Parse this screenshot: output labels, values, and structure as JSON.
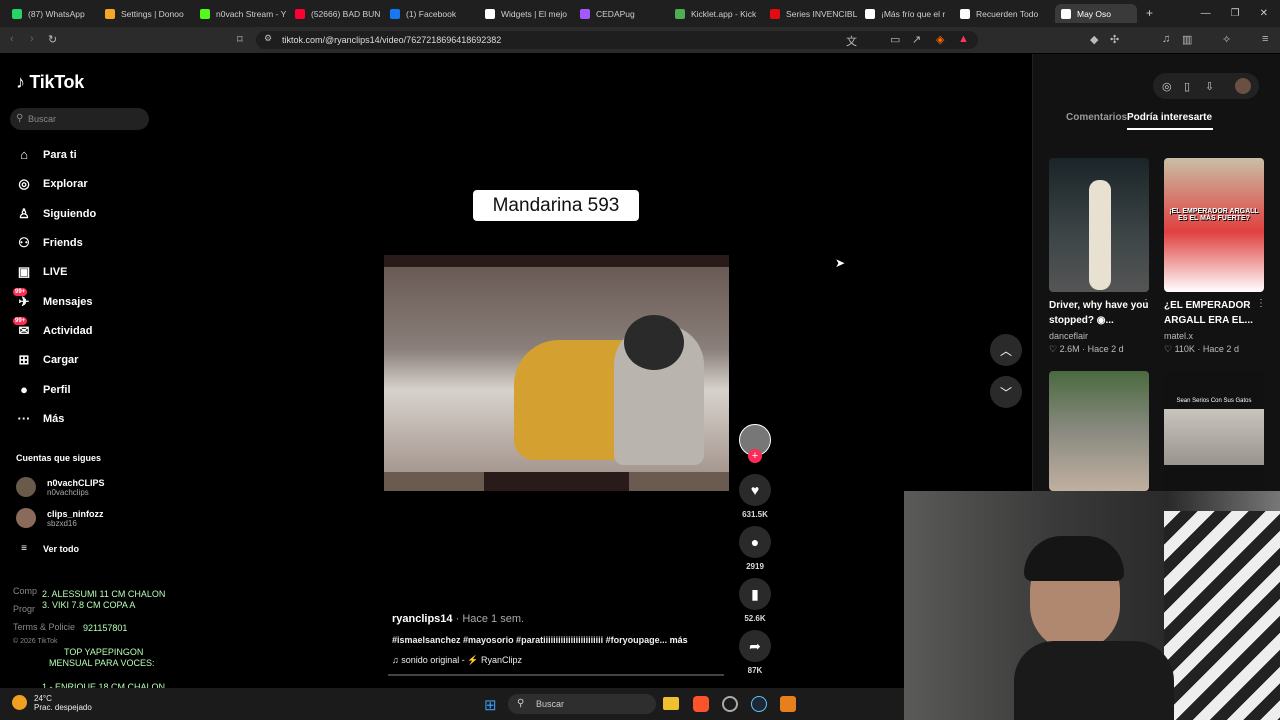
{
  "browser": {
    "tabs": [
      {
        "label": "(87) WhatsApp",
        "color": "#25d366"
      },
      {
        "label": "Settings | Donoo",
        "color": "#f5a623"
      },
      {
        "label": "n0vach Stream - Y",
        "color": "#53fc18"
      },
      {
        "label": "(52666) BAD BUN",
        "color": "#ff0033"
      },
      {
        "label": "(1) Facebook",
        "color": "#1877f2"
      },
      {
        "label": "Widgets | El mejo",
        "color": "#ffffff"
      },
      {
        "label": "CEDAPug",
        "color": "#a259ff"
      },
      {
        "label": "Kicklet.app - Kick",
        "color": "#4caf50"
      },
      {
        "label": "Series INVENCIBL",
        "color": "#e50914"
      },
      {
        "label": "¡Más frío que el r",
        "color": "#ffffff"
      },
      {
        "label": "Recuerden Todo",
        "color": "#ffffff"
      },
      {
        "label": "May Oso",
        "color": "#ffffff"
      }
    ],
    "new_tab": "+",
    "url": "tiktok.com/@ryanclips14/video/7627218696418692382"
  },
  "sidebar": {
    "logo": "TikTok",
    "search_placeholder": "Buscar",
    "items": [
      {
        "label": "Para ti",
        "icon": "⌂"
      },
      {
        "label": "Explorar",
        "icon": "◎"
      },
      {
        "label": "Siguiendo",
        "icon": "♙"
      },
      {
        "label": "Friends",
        "icon": "⚇"
      },
      {
        "label": "LIVE",
        "icon": "▣"
      },
      {
        "label": "Mensajes",
        "icon": "✈",
        "badge": "99+"
      },
      {
        "label": "Actividad",
        "icon": "✉",
        "badge": "99+"
      },
      {
        "label": "Cargar",
        "icon": "⊞"
      },
      {
        "label": "Perfil",
        "icon": "●"
      },
      {
        "label": "Más",
        "icon": "···"
      }
    ],
    "following_title": "Cuentas que sigues",
    "following": [
      {
        "name": "n0vachCLIPS",
        "user": "n0vachclips"
      },
      {
        "name": "clips_ninfozz",
        "user": "sbzxd16"
      }
    ],
    "see_all": "Ver todo",
    "footer": [
      "Comp",
      "Progr",
      "Terms & Policie",
      "© 2026 TikTok"
    ]
  },
  "overlay": {
    "line1": "2. ALESSUMI 11 CM CHALON",
    "line2": "3. VIKI 7.8 CM COPA A",
    "line3": "921157801",
    "line4": "TOP YAPEPINGON",
    "line5": "MENSUAL PARA VOCES:",
    "line6": "1.- ENRIQUE 18 CM CHALON"
  },
  "video": {
    "caption": "Mandarina 593",
    "author": "ryanclips14",
    "time": " · Hace 1 sem.",
    "tags": "#ismaelsanchez #mayosorio #parati​iiiiiiiiiiiiiiiiiiiiiii #foryoupage...",
    "more": "más",
    "sound": "sonido original - ⚡ RyanClipz",
    "likes": "631.5K",
    "comments": "2919",
    "saves": "52.6K",
    "shares": "87K",
    "progress": 0
  },
  "right_panel": {
    "tab_comments": "Comentarios",
    "tab_interest": "Podría interesarte",
    "cards": [
      {
        "title": "Driver, why have you stopped? ◉...",
        "author": "danceflair",
        "likes": "♡ 2.6M",
        "when": "Hace 2 d"
      },
      {
        "title": "¿EL EMPERADOR ARGALL ERA EL...",
        "author": "matel.x",
        "likes": "♡ 110K",
        "when": "Hace 2 d"
      }
    ],
    "thumb2_text": "¡EL EMPERADOR ARGALL ES EL MÁS FUERTE?",
    "thumb4_text": "Sean Serios Con Sus Gatos"
  },
  "taskbar": {
    "temp": "24°C",
    "weather": "Prac. despejado",
    "search": "Buscar"
  }
}
